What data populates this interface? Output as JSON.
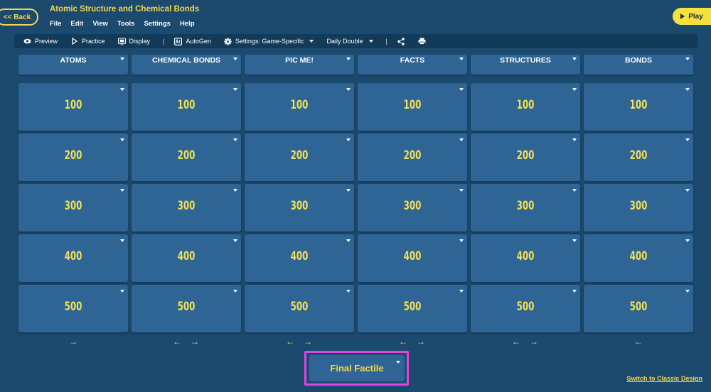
{
  "header": {
    "back_label": "<< Back",
    "title": "Atomic Structure and Chemical Bonds",
    "menu": [
      "File",
      "Edit",
      "View",
      "Tools",
      "Settings",
      "Help"
    ],
    "play_label": "Play"
  },
  "toolbar": {
    "preview": "Preview",
    "practice": "Practice",
    "display": "Display",
    "sep": "|",
    "autogen": "AutoGen",
    "settings": "Settings: Game-Specific",
    "daily_double": "Daily Double",
    "sep2": "|"
  },
  "board": {
    "categories": [
      "ATOMS",
      "CHEMICAL BONDS",
      "PIC ME!",
      "FACTS",
      "STRUCTURES",
      "BONDS"
    ],
    "values": [
      "100",
      "200",
      "300",
      "400",
      "500"
    ]
  },
  "arrows": {
    "right": "→",
    "left": "←"
  },
  "final": {
    "label": "Final Factile"
  },
  "footer": {
    "switch_label": "Switch to Classic Design"
  },
  "colors": {
    "background": "#1c4a6e",
    "tile": "#2e6595",
    "accent": "#f3d54e",
    "value": "#f3e052",
    "highlight": "#e044e0"
  }
}
